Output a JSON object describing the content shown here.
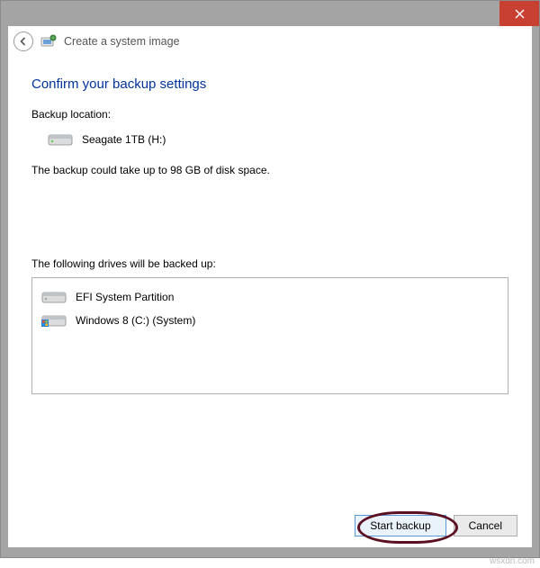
{
  "window": {
    "title": "Create a system image"
  },
  "heading": "Confirm your backup settings",
  "labels": {
    "backup_location": "Backup location:",
    "location_value": "Seagate 1TB (H:)",
    "space_estimate": "The backup could take up to 98 GB of disk space.",
    "following_drives": "The following drives will be backed up:"
  },
  "drives": [
    {
      "name": "EFI System Partition"
    },
    {
      "name": "Windows 8 (C:) (System)"
    }
  ],
  "buttons": {
    "start": "Start backup",
    "cancel": "Cancel"
  },
  "watermark": "wsxdn.com"
}
